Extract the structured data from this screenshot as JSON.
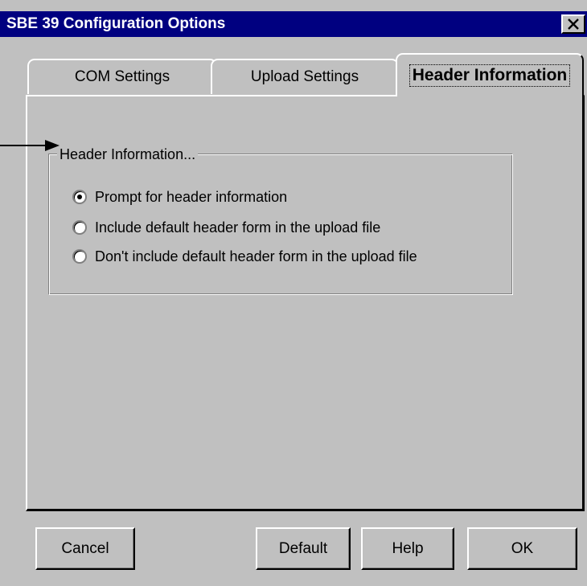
{
  "window": {
    "title": "SBE 39 Configuration Options",
    "close_glyph": "×"
  },
  "tabs": [
    {
      "label": "COM Settings",
      "selected": false
    },
    {
      "label": "Upload Settings",
      "selected": false
    },
    {
      "label": "Header Information",
      "selected": true
    }
  ],
  "group": {
    "label": "Header Information...",
    "options": [
      {
        "label": "Prompt for header information",
        "selected": true
      },
      {
        "label": "Include default header form in the upload file",
        "selected": false
      },
      {
        "label": "Don't include default header form in the upload file",
        "selected": false
      }
    ]
  },
  "buttons": {
    "cancel": "Cancel",
    "default": "Default",
    "help": "Help",
    "ok": "OK"
  },
  "annotation": {
    "arrow_icon": "right-arrow-icon"
  },
  "colors": {
    "titlebar": "#000080",
    "face": "#c0c0c0",
    "highlight": "#ffffff",
    "shadow": "#808080"
  }
}
